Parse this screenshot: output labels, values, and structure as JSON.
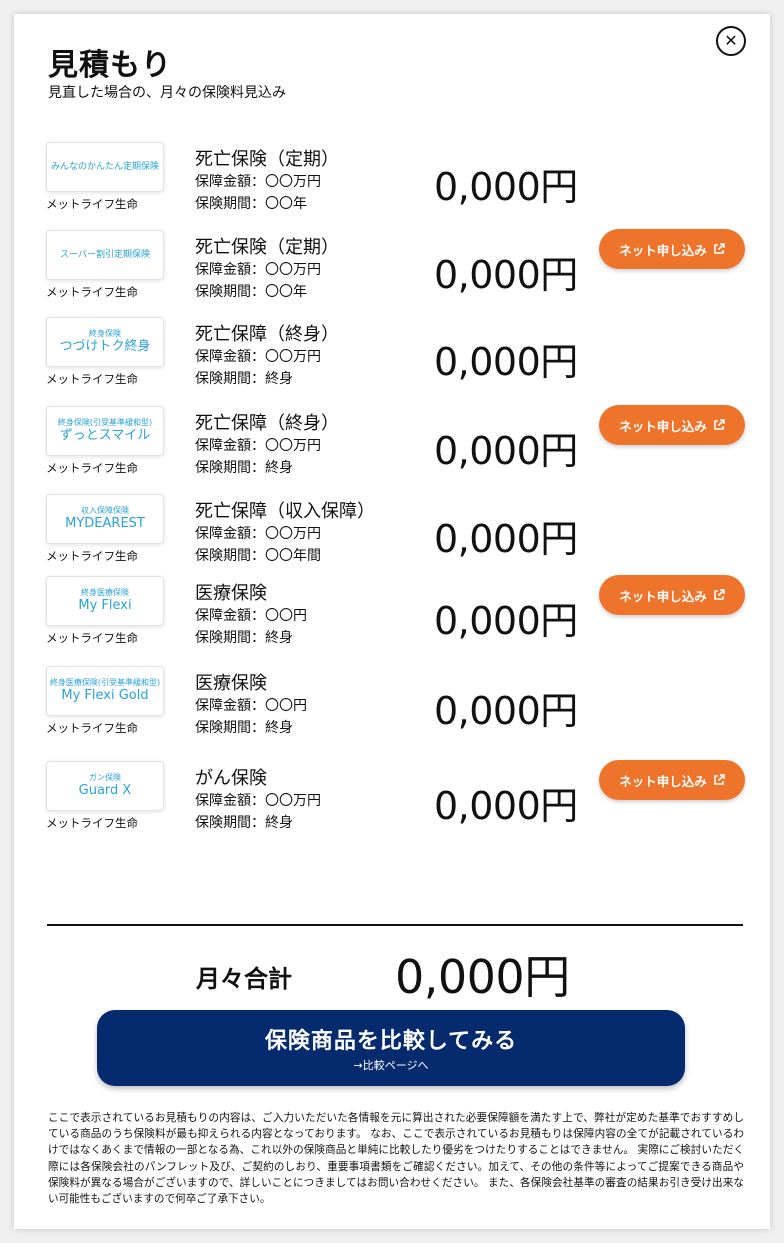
{
  "header": {
    "title": "見積もり",
    "subtitle": "見直した場合の、月々の保険料見込み"
  },
  "close_icon": "close-circle-icon",
  "accent_color": "#ee742b",
  "navy_color": "#062a6e",
  "logo_color": "#27a3d9",
  "net_apply_label": "ネット申し込み",
  "products": [
    {
      "logo": {
        "small": "",
        "big": "みんなのかんたん定期保険"
      },
      "company": "メットライフ生命",
      "type": "死亡保険（定期）",
      "amount": "保障金額：〇〇万円",
      "term": "保険期間：〇〇年",
      "price": "0,000円",
      "net_apply": false
    },
    {
      "logo": {
        "small": "",
        "big": "スーパー割引定期保険"
      },
      "company": "メットライフ生命",
      "type": "死亡保険（定期）",
      "amount": "保障金額：〇〇万円",
      "term": "保険期間：〇〇年",
      "price": "0,000円",
      "net_apply": true
    },
    {
      "logo": {
        "small": "終身保険",
        "big": "つづけトク終身"
      },
      "company": "メットライフ生命",
      "type": "死亡保障（終身）",
      "amount": "保障金額：〇〇万円",
      "term": "保険期間：終身",
      "price": "0,000円",
      "net_apply": false
    },
    {
      "logo": {
        "small": "終身保険(引受基準緩和型)",
        "big": "ずっとスマイル"
      },
      "company": "メットライフ生命",
      "type": "死亡保障（終身）",
      "amount": "保障金額：〇〇万円",
      "term": "保険期間：終身",
      "price": "0,000円",
      "net_apply": true
    },
    {
      "logo": {
        "small": "収入保障保険",
        "big": "MYDEAREST"
      },
      "company": "メットライフ生命",
      "type": "死亡保障（収入保障）",
      "amount": "保障金額：〇〇万円",
      "term": "保険期間：〇〇年間",
      "price": "0,000円",
      "net_apply": false
    },
    {
      "logo": {
        "small": "終身医療保険",
        "big": "My Flexi"
      },
      "company": "メットライフ生命",
      "type": "医療保険",
      "amount": "保障金額：〇〇円",
      "term": "保険期間：終身",
      "price": "0,000円",
      "net_apply": true
    },
    {
      "logo": {
        "small": "終身医療保険(引受基準緩和型)",
        "big": "My Flexi Gold"
      },
      "company": "メットライフ生命",
      "type": "医療保険",
      "amount": "保障金額：〇〇円",
      "term": "保険期間：終身",
      "price": "0,000円",
      "net_apply": false
    },
    {
      "logo": {
        "small": "ガン保険",
        "big": "Guard X"
      },
      "company": "メットライフ生命",
      "type": "がん保険",
      "amount": "保障金額：〇〇万円",
      "term": "保険期間：終身",
      "price": "0,000円",
      "net_apply": true
    }
  ],
  "total": {
    "label": "月々合計",
    "value": "0,000円"
  },
  "compare_button": {
    "label": "保険商品を比較してみる",
    "sub": "→比較ページへ"
  },
  "disclaimer": "ここで表示されているお見積もりの内容は、ご入力いただいた各情報を元に算出された必要保障額を満たす上で、弊社が定めた基準でおすすめしている商品のうち保険料が最も抑えられる内容となっております。 なお、ここで表示されているお見積もりは保障内容の全てが記載されているわけではなくあくまで情報の一部となる為、これ以外の保険商品と単純に比較したり優劣をつけたりすることはできません。 実際にご検討いただく際には各保険会社のパンフレット及び、ご契約のしおり、重要事項書類をご確認ください。加えて、その他の条件等によってご提案できる商品や保険料が異なる場合がございますので、詳しいことにつきましてはお問い合わせください。 また、各保険会社基準の審査の結果お引き受け出来ない可能性もございますので何卒ご了承下さい。"
}
